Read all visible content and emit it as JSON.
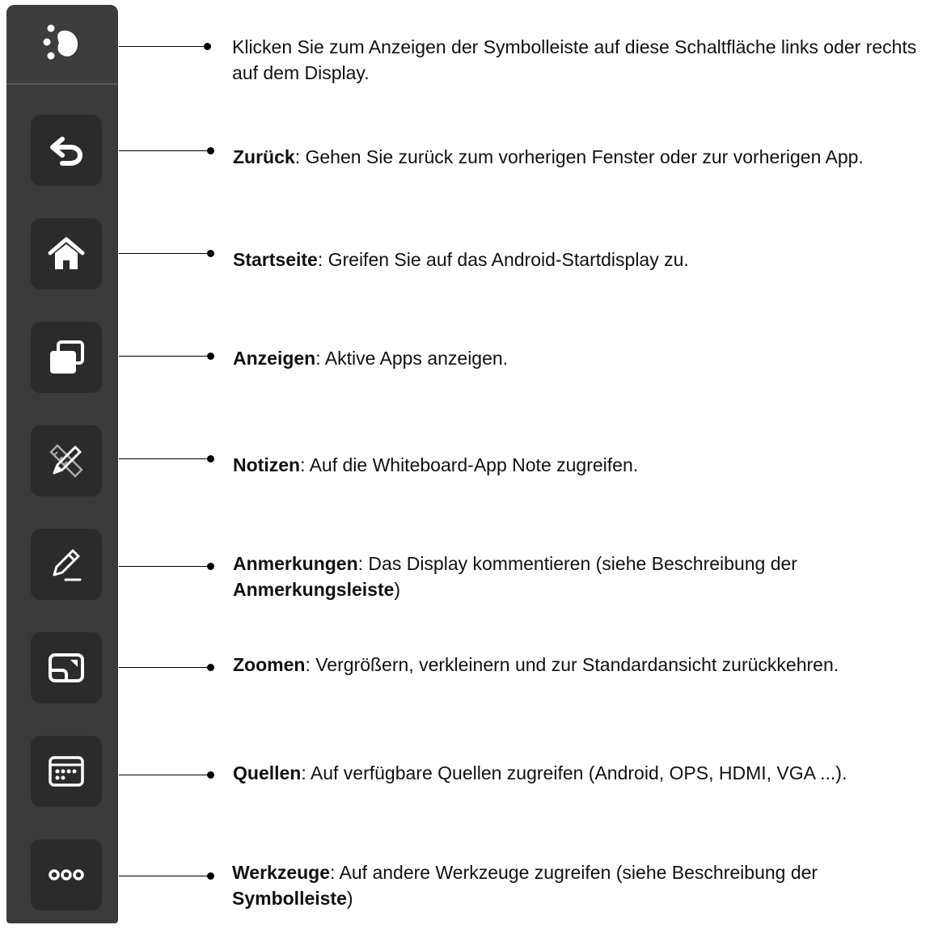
{
  "toolbar": {
    "handle_icon": "toolbar-toggle-icon",
    "buttons": [
      {
        "id": "back",
        "icon": "back-arrow-icon"
      },
      {
        "id": "home",
        "icon": "home-icon"
      },
      {
        "id": "view",
        "icon": "windows-icon"
      },
      {
        "id": "notes",
        "icon": "pencil-ruler-icon"
      },
      {
        "id": "annotate",
        "icon": "pen-underline-icon"
      },
      {
        "id": "zoom",
        "icon": "zoom-window-icon"
      },
      {
        "id": "sources",
        "icon": "sources-panel-icon"
      },
      {
        "id": "tools",
        "icon": "more-dots-icon"
      }
    ]
  },
  "descriptions": {
    "toggle": {
      "text": "Klicken Sie zum Anzeigen der Symbolleiste auf diese Schaltfläche links oder rechts auf dem Display."
    },
    "back": {
      "term": "Zurück",
      "text": ": Gehen Sie zurück zum vorherigen Fenster oder zur vorherigen App."
    },
    "home": {
      "term": "Startseite",
      "text": ": Greifen Sie auf das Android-Startdisplay zu."
    },
    "view": {
      "term": "Anzeigen",
      "text": ": Aktive Apps anzeigen."
    },
    "notes": {
      "term": "Notizen",
      "text": ": Auf die Whiteboard-App Note zugreifen."
    },
    "annotate": {
      "term": "Anmerkungen",
      "text": ": Das Display kommentieren (siehe Beschreibung der ",
      "term2": "Anmerkungsleiste",
      "tail": ")"
    },
    "zoom": {
      "term": "Zoomen",
      "text": ": Vergrößern, verkleinern und zur Standardansicht zurückkehren."
    },
    "sources": {
      "term": "Quellen",
      "text": ": Auf verfügbare Quellen zugreifen (Android, OPS, HDMI, VGA ...)."
    },
    "tools": {
      "term": "Werkzeuge",
      "text": ": Auf andere Werkzeuge zugreifen (siehe Beschreibung der ",
      "term2": "Symbolleiste",
      "tail": ")"
    }
  },
  "colors": {
    "toolbar_bg": "#3a3a3a",
    "button_bg": "#2b2b2b",
    "icon": "#ffffff"
  }
}
